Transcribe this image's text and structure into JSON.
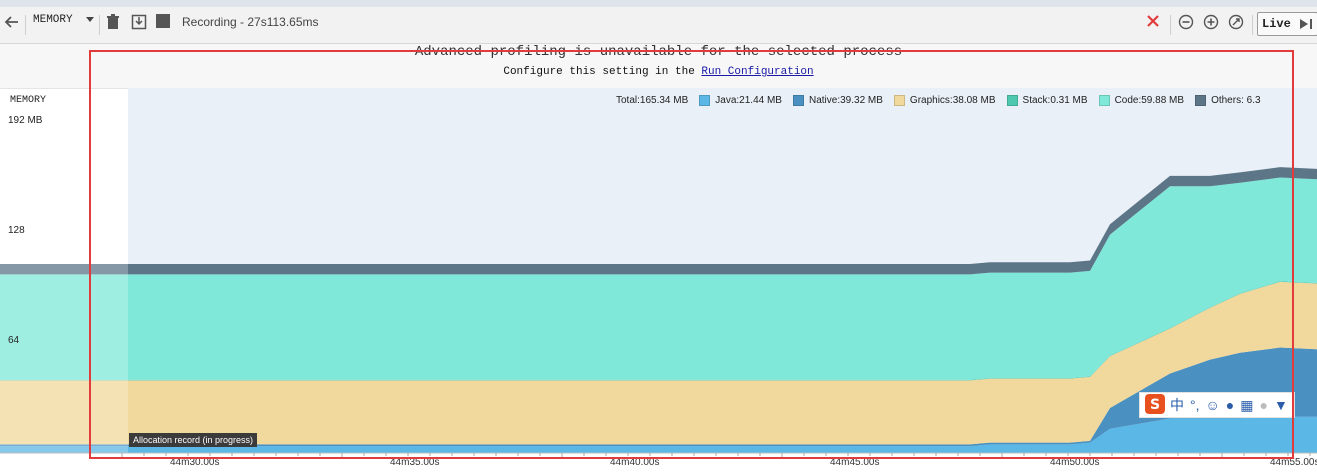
{
  "toolbar": {
    "back_icon": "arrow-left-icon",
    "monitor_select": "MEMORY",
    "recording_label": "Recording - 27s113.65ms",
    "live_label": "Live",
    "colors": {
      "stop": "#e23b3b"
    }
  },
  "banner": {
    "message": "Advanced profiling is unavailable for the selected process",
    "config_prefix": "Configure this setting in the",
    "config_link": "Run Configuration"
  },
  "chart_data": {
    "type": "area",
    "title": "MEMORY",
    "ylabel": "",
    "y_ticks": [
      "192 MB",
      "128",
      "64"
    ],
    "ylim": [
      0,
      192
    ],
    "x_tick_labels": [
      "44m30.00s",
      "44m35.00s",
      "44m40.00s",
      "44m45.00s",
      "44m50.00s",
      "44m55.00s"
    ],
    "legend": [
      {
        "label": "Total:165.34 MB",
        "color": null
      },
      {
        "label": "Java:21.44 MB",
        "color": "#5bb7e5"
      },
      {
        "label": "Native:39.32 MB",
        "color": "#4a90c0"
      },
      {
        "label": "Graphics:38.08 MB",
        "color": "#f1d89c"
      },
      {
        "label": "Stack:0.31 MB",
        "color": "#4fc8b0"
      },
      {
        "label": "Code:59.88 MB",
        "color": "#7fe8d8"
      },
      {
        "label": "Others: 6.3",
        "color": "#5c7688"
      }
    ],
    "x": [
      0,
      1,
      2,
      3,
      4,
      5,
      6,
      7,
      8,
      9,
      10,
      11,
      12,
      13,
      14,
      15,
      16,
      17,
      18,
      19,
      20
    ],
    "series": [
      {
        "name": "Java",
        "values": [
          4,
          4,
          4,
          4,
          4,
          4,
          4,
          4,
          4,
          4,
          5,
          5,
          5,
          5,
          6,
          14,
          20,
          20,
          20,
          21,
          21
        ]
      },
      {
        "name": "Native",
        "values": [
          1,
          1,
          1,
          1,
          1,
          1,
          1,
          1,
          1,
          1,
          1,
          1,
          1,
          1,
          1,
          12,
          26,
          34,
          38,
          40,
          39
        ]
      },
      {
        "name": "Graphics",
        "values": [
          37,
          37,
          37,
          37,
          37,
          37,
          37,
          37,
          37,
          37,
          37,
          37,
          37,
          37,
          37,
          30,
          26,
          30,
          34,
          38,
          38
        ]
      },
      {
        "name": "Stack",
        "values": [
          0.3,
          0.3,
          0.3,
          0.3,
          0.3,
          0.3,
          0.3,
          0.3,
          0.3,
          0.3,
          0.3,
          0.3,
          0.3,
          0.3,
          0.3,
          0.3,
          0.3,
          0.3,
          0.3,
          0.3,
          0.3
        ]
      },
      {
        "name": "Code",
        "values": [
          61,
          61,
          61,
          61,
          61,
          61,
          61,
          61,
          61,
          61,
          61,
          61,
          61,
          61,
          61,
          70,
          82,
          70,
          64,
          60,
          60
        ]
      },
      {
        "name": "Others",
        "values": [
          6,
          6,
          6,
          6,
          6,
          6,
          6,
          6,
          6,
          6,
          6,
          6,
          6,
          6,
          6,
          6,
          6,
          6,
          6,
          6,
          6
        ]
      }
    ]
  },
  "tooltip": "Allocation record (in progress)",
  "ime_toolbar": {
    "chinese_label": "中"
  }
}
